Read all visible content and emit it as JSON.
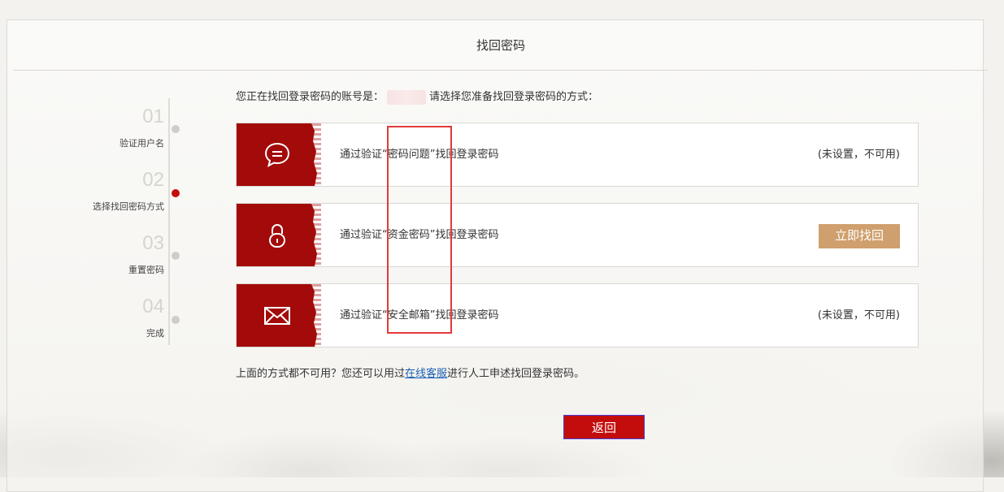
{
  "panel": {
    "title": "找回密码"
  },
  "steps": [
    {
      "num": "01",
      "label": "验证用户名",
      "active": false
    },
    {
      "num": "02",
      "label": "选择找回密码方式",
      "active": true
    },
    {
      "num": "03",
      "label": "重置密码",
      "active": false
    },
    {
      "num": "04",
      "label": "完成",
      "active": false
    }
  ],
  "intro": {
    "prefix": "您正在找回登录密码的账号是：",
    "suffix": "请选择您准备找回登录密码的方式："
  },
  "options": [
    {
      "icon": "chat-bubble-icon",
      "text": "通过验证“密码问题”找回登录密码",
      "status": "(未设置，不可用)"
    },
    {
      "icon": "lock-icon",
      "text": "通过验证“资金密码”找回登录密码",
      "action": "立即找回"
    },
    {
      "icon": "envelope-icon",
      "text": "通过验证“安全邮箱”找回登录密码",
      "status": "(未设置，不可用)"
    }
  ],
  "footer": {
    "prefix": "上面的方式都不可用？您还可以用过",
    "link": "在线客服",
    "suffix": "进行人工申述找回登录密码。"
  },
  "back_button": "返回",
  "colors": {
    "brand_red": "#a30a0a",
    "button_red": "#c30d0d",
    "action_tan": "#cf9f6d",
    "highlight": "#e4393c"
  }
}
